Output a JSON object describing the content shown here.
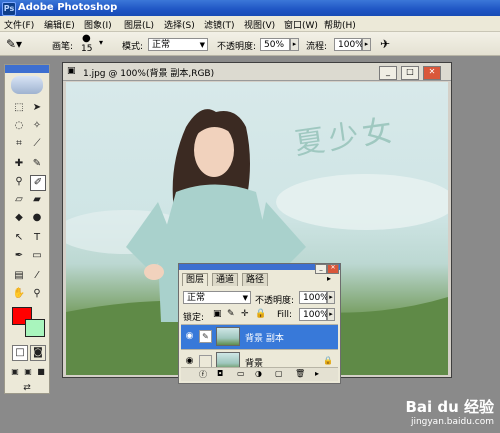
{
  "app": {
    "title": "Adobe Photoshop"
  },
  "menu": [
    "文件(F)",
    "编辑(E)",
    "图象(I)",
    "图层(L)",
    "选择(S)",
    "滤镜(T)",
    "视图(V)",
    "窗口(W)",
    "帮助(H)"
  ],
  "options": {
    "brush_label": "画笔:",
    "brush_size": "15",
    "mode_label": "模式:",
    "mode_value": "正常",
    "opacity_label": "不透明度:",
    "opacity_value": "50%",
    "flow_label": "流程:",
    "flow_value": "100%"
  },
  "document": {
    "title": "1.jpg @ 100%(背景 副本,RGB)",
    "calligraphy": "夏少女"
  },
  "layers_panel": {
    "tabs": [
      "图层",
      "通道",
      "路径"
    ],
    "blend_mode": "正常",
    "opacity_label": "不透明度:",
    "opacity_value": "100%",
    "lock_label": "锁定:",
    "fill_label": "Fill:",
    "fill_value": "100%",
    "layers": [
      {
        "name": "背景 副本",
        "selected": true
      },
      {
        "name": "背景",
        "selected": false
      }
    ]
  },
  "watermark": {
    "brand": "Bai du 经验",
    "url": "jingyan.baidu.com"
  }
}
